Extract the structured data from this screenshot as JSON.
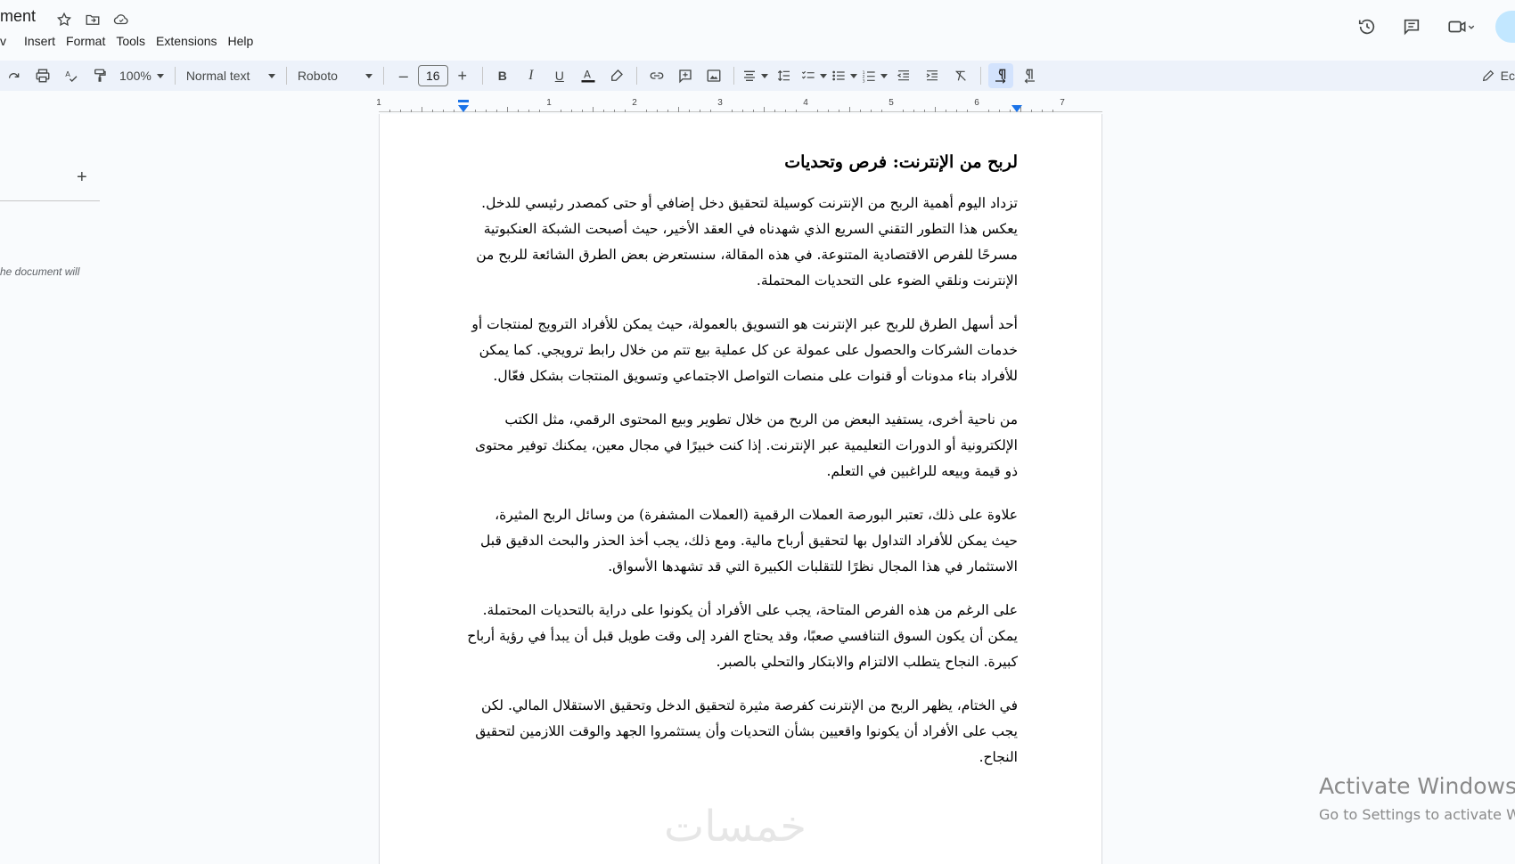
{
  "header": {
    "doc_title": "ment",
    "menu": [
      "v",
      "Insert",
      "Format",
      "Tools",
      "Extensions",
      "Help"
    ]
  },
  "toolbar": {
    "zoom": "100%",
    "style": "Normal text",
    "font": "Roboto",
    "font_size": "16",
    "edit_label": "Ec"
  },
  "ruler": {
    "numbers": [
      "1",
      "1",
      "2",
      "3",
      "4",
      "5",
      "6",
      "7"
    ]
  },
  "outline": {
    "hint": "he document will"
  },
  "document": {
    "heading": "لربح من الإنترنت: فرص وتحديات",
    "paragraphs": [
      "تزداد اليوم أهمية الربح من الإنترنت كوسيلة لتحقيق دخل إضافي أو حتى كمصدر رئيسي للدخل. يعكس هذا التطور التقني السريع الذي شهدناه في العقد الأخير، حيث أصبحت الشبكة العنكبوتية مسرحًا للفرص الاقتصادية المتنوعة. في هذه المقالة، سنستعرض بعض الطرق الشائعة للربح من الإنترنت ونلقي الضوء على التحديات المحتملة.",
      "أحد أسهل الطرق للربح عبر الإنترنت هو التسويق بالعمولة، حيث يمكن للأفراد الترويج لمنتجات أو خدمات الشركات والحصول على عمولة عن كل عملية بيع تتم من خلال رابط ترويجي. كما يمكن للأفراد بناء مدونات أو قنوات على منصات التواصل الاجتماعي وتسويق المنتجات بشكل فعّال.",
      "من ناحية أخرى، يستفيد البعض من الربح من خلال تطوير وبيع المحتوى الرقمي، مثل الكتب الإلكترونية أو الدورات التعليمية عبر الإنترنت. إذا كنت خبيرًا في مجال معين، يمكنك توفير محتوى ذو قيمة وبيعه للراغبين في التعلم.",
      "علاوة على ذلك، تعتبر البورصة العملات الرقمية (العملات المشفرة) من وسائل الربح المثيرة، حيث يمكن للأفراد التداول بها لتحقيق أرباح مالية. ومع ذلك، يجب أخذ الحذر والبحث الدقيق قبل الاستثمار في هذا المجال نظرًا للتقلبات الكبيرة التي قد تشهدها الأسواق.",
      "على الرغم من هذه الفرص المتاحة، يجب على الأفراد أن يكونوا على دراية بالتحديات المحتملة. يمكن أن يكون السوق التنافسي صعبًا، وقد يحتاج الفرد إلى وقت طويل قبل أن يبدأ في رؤية أرباح كبيرة. النجاح يتطلب الالتزام والابتكار والتحلي بالصبر.",
      "في الختام، يظهر الربح من الإنترنت كفرصة مثيرة لتحقيق الدخل وتحقيق الاستقلال المالي. لكن يجب على الأفراد أن يكونوا واقعيين بشأن التحديات وأن يستثمروا الجهد والوقت اللازمين لتحقيق النجاح."
    ]
  },
  "watermark": "خمسات",
  "activate": {
    "line1": "Activate Windows",
    "line2": "Go to Settings to activate W"
  }
}
